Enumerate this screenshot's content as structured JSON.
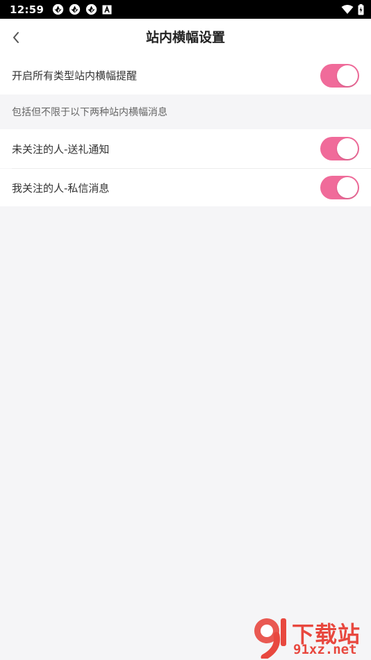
{
  "status_bar": {
    "time": "12:59",
    "left_icons": [
      "aperture-icon",
      "aperture-icon",
      "aperture-icon",
      "font-a-icon"
    ],
    "right_icons": [
      "wifi-icon",
      "battery-charging-icon"
    ]
  },
  "header": {
    "back_icon": "chevron-left-icon",
    "title": "站内横幅设置"
  },
  "settings": {
    "main": {
      "label": "开启所有类型站内横幅提醒",
      "enabled": true
    },
    "section_note": "包括但不限于以下两种站内横幅消息",
    "items": [
      {
        "label": "未关注的人-送礼通知",
        "enabled": true
      },
      {
        "label": "我关注的人-私信消息",
        "enabled": true
      }
    ]
  },
  "watermark": {
    "logo_text": "下载站",
    "url": "91xz.net"
  },
  "colors": {
    "accent": "#f06b9a",
    "background": "#f5f5f7",
    "watermark": "#e8483f"
  }
}
